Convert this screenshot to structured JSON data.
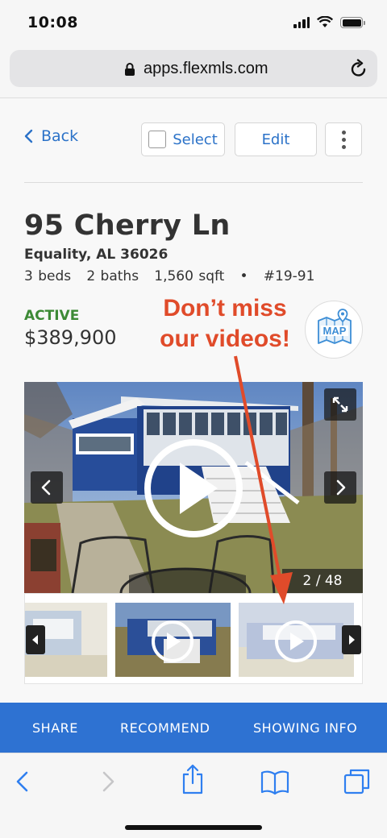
{
  "status_bar": {
    "time": "10:08"
  },
  "browser": {
    "url": "apps.flexmls.com"
  },
  "nav": {
    "back_label": "Back",
    "select_label": "Select",
    "edit_label": "Edit"
  },
  "listing": {
    "address": "95 Cherry Ln",
    "city_state_zip": "Equality, AL 36026",
    "facts": "3 beds   2 baths   1,560 sqft   •   #19-91",
    "status": "ACTIVE",
    "price": "$389,900",
    "map_label": "MAP"
  },
  "promo": {
    "line1": "Don’t miss",
    "line2": "our videos!",
    "color": "#e04b2a"
  },
  "gallery": {
    "counter": "2 / 48"
  },
  "actions": {
    "share": "SHARE",
    "recommend": "RECOMMEND",
    "showing_info": "SHOWING INFO"
  },
  "colors": {
    "accent": "#2b72c8",
    "action_bar": "#2e72d2",
    "status_active": "#3d8a36"
  }
}
